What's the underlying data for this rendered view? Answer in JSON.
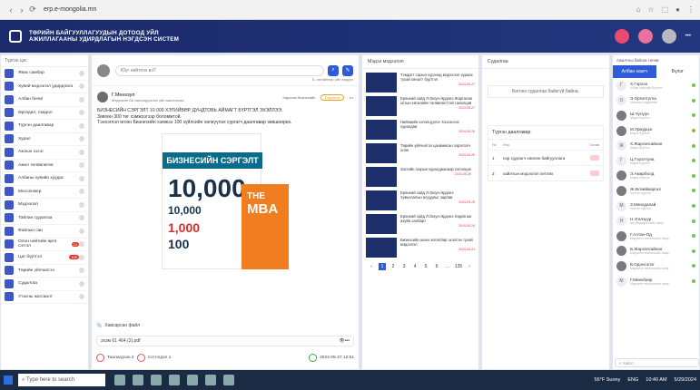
{
  "browser": {
    "url": "erp.e-mongolia.mn"
  },
  "app": {
    "title_line1": "ТӨРИЙН БАЙГУУЛЛАГУУДЫН ДОТООД УЙЛ",
    "title_line2": "АЖИЛЛАГААНЫ УДИРДЛАГЫН НЭГДСЭН СИСТЕМ"
  },
  "left_menu": {
    "title": "Түргэн цэс",
    "items": [
      {
        "label": "Явах самбар"
      },
      {
        "label": "Хувий мэдээлэл удирдлага"
      },
      {
        "label": "Албан бичиг"
      },
      {
        "label": "Өргөдөл, гомдол"
      },
      {
        "label": "Түргэн даалгавар"
      },
      {
        "label": "Хурал"
      },
      {
        "label": "Ажлын хэсэг"
      },
      {
        "label": "Ажил төлөвлөгөө"
      },
      {
        "label": "Албаны хувийн хуудас"
      },
      {
        "label": "Мессенжер"
      },
      {
        "label": "Мэдээлэл"
      },
      {
        "label": "Тайлан судалгаа"
      },
      {
        "label": "Файлын сан"
      },
      {
        "label": "Олон нийтийн өргө сэтгэл",
        "badge": "12"
      },
      {
        "label": "Цаг бүртгэл",
        "badge": "100"
      },
      {
        "label": "Төрийн үйлчилгээ"
      },
      {
        "label": "Судалгаа"
      },
      {
        "label": "Утасны жагсаалт"
      }
    ]
  },
  "feed": {
    "composer_placeholder": "Юуг нийтлэх вэ?",
    "public_note": "Б. энгийнээр үйл харуул",
    "post": {
      "author": "Г.Мөнхзул",
      "author_sub": "Мэдээлэл ба танилцуулгын үйл ажиллагаа",
      "actions": {
        "save": "Харьсан бизнесийн",
        "reply": "Үлдээсэн",
        "more": "•••"
      },
      "body_1": "БИЗНЕСИЙН СЭРГЭЛТ 10 000 ХЭТИЙВӨР ДУНДТОВЬ АЙМАГТ БҮРТГЭЛ ЭХЭЛЛЭЭ.",
      "body_2": "Зөвхөн 300 төг хэмжээгээр боломжтой.",
      "body_3": "Тэнхэглэл өгсөн Бизнесийн хэмжээ 100 зүйлсийн хөгжүүлэх сургагч даалгавар зөвшөөрөх.",
      "cover_band": "БИЗНЕСИЙН СЭРГЭЛТ",
      "cover_big": "10,000",
      "cover_small": "10,000",
      "cover_mid": "1,000",
      "cover_low": "100",
      "cover_right_1": "THE",
      "cover_right_2": "MBA"
    },
    "attachment_title": "Хавсарсан файл",
    "file_name": "эхэм 61 464 (2).pdf",
    "likes": {
      "count_label": "Таалагдсан 2",
      "comments": "Сэтгэгдэл 1"
    },
    "date": "2024-05-27 12:51"
  },
  "news": {
    "title": "Мэдээ мэдээлэл",
    "items": [
      {
        "text": "Тэмдэгт сарын хүрээнд мэдээлэл хураах тухай хяналт бүртгэл",
        "date": "2024-05-27"
      },
      {
        "text": "Ерөнхий сайд Л.Оюун-Эрдэнэ Жаргалан хотын хөгжлийн төлөвлөлттэй танилцав",
        "date": "2024-05-27"
      },
      {
        "text": "Нийгмийн хэлэлцүүлэг Хэзээнээс хуралдав",
        "date": "2024-05-26"
      },
      {
        "text": "Төрийн үйлчилгээ цахимжсан хэрэглэгч олон",
        "date": "2024-05-26"
      },
      {
        "text": "Засгийн газрын хуралдаанаар хэлэлцэв",
        "date": "2024-05-25"
      },
      {
        "text": "Ерөнхий сайд Л.Оюун-Эрдэнэ Хувьчлалын асуудлыг зарлав",
        "date": "2024-05-25"
      },
      {
        "text": "Ерөнхий сайд Л.Оюун-Эрдэнэ Хөдөө аж ахуйн салбарт",
        "date": "2024-05-24"
      },
      {
        "text": "Бизнесийн шинэ хөтөлбөр эхэлсэн тухай мэдээлэл",
        "date": "2024-05-24"
      }
    ],
    "pages": [
      "1",
      "2",
      "3",
      "4",
      "5",
      "6",
      "…",
      "135"
    ]
  },
  "poll": {
    "title": "Судалгаа",
    "empty_text": "Бөглөх судалгаа байхгүй байна.",
    "ann_title": "Түргэн даалгавар",
    "ann_cols": [
      "№",
      "Нэр",
      "Төлөв"
    ],
    "ann_rows": [
      {
        "num": "1",
        "name": "нэр судлагч хөөсөн байгууллага"
      },
      {
        "num": "2",
        "name": "хайлтын мэдээлэл хөтлөх"
      }
    ]
  },
  "people": {
    "title": "Ажилтны байгаа төлөв",
    "tabs": [
      "Албан хаагч",
      "Бүлэг"
    ],
    "search_placeholder": "Хайлт",
    "list": [
      {
        "initial": "Г",
        "name": "Х.Гэрлэн",
        "sub": "Албан хаагчийн бүртгэл"
      },
      {
        "initial": "О",
        "name": "Э.Оргилтулга",
        "sub": "Шилжилт хөдөлгөөн"
      },
      {
        "initial": "",
        "name": "Ш.Чүлүүн",
        "sub": "Мэдээ бүртгэл"
      },
      {
        "initial": "",
        "name": "М.Урмурцэг",
        "sub": "Мэдээ бүртгэл"
      },
      {
        "initial": "Ж",
        "name": "Х.Жаргалсайхан",
        "sub": "Мэдээ бүртгэл"
      },
      {
        "initial": "Г",
        "name": "Ц.Гэрэлтуяа",
        "sub": "Мэдээ бүртгэл"
      },
      {
        "initial": "",
        "name": "Э.Амарболд",
        "sub": "Мэдээ бүртгэл"
      },
      {
        "initial": "",
        "name": "Ж.Өлзийжаргал",
        "sub": "Нэгтгэл хүргэлт"
      },
      {
        "initial": "М",
        "name": "З.Мөнхдалай",
        "sub": "Нэгтгэл хүргэлт"
      },
      {
        "initial": "Н",
        "name": "Н.Угалзуур",
        "sub": "Аж үйлдвэрлэлийн газар"
      },
      {
        "initial": "",
        "name": "Г.Алтан-Од",
        "sub": "Мэдээлэл технологийн газар"
      },
      {
        "initial": "",
        "name": "Б.Жаргалсайхан",
        "sub": "Мэдээлэл технологийн газар"
      },
      {
        "initial": "",
        "name": "Б.Одонсэлэг",
        "sub": "Мэдээлэл технологийн газар"
      },
      {
        "initial": "М",
        "name": "Г.Мөнхбаяр",
        "sub": "Мэдээлэл технологийн газар"
      }
    ]
  },
  "taskbar": {
    "search": "Type here to search",
    "weather": "56°F Sunny",
    "lang": "ENG",
    "time": "10:40 AM",
    "date": "5/29/2024"
  }
}
